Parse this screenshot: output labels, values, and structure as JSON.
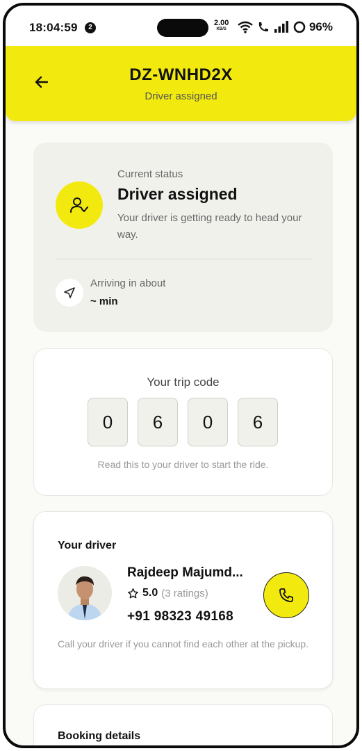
{
  "status_bar": {
    "time": "18:04:59",
    "notification_count": "2",
    "speed_value": "2.00",
    "speed_unit": "KB/S",
    "battery": "96%"
  },
  "header": {
    "title": "DZ-WNHD2X",
    "subtitle": "Driver assigned",
    "accent_color": "#f2ea0f"
  },
  "status_card": {
    "label": "Current status",
    "title": "Driver assigned",
    "description": "Your driver is getting ready to head your way.",
    "arrival_label": "Arriving in about",
    "arrival_value": "~ min"
  },
  "trip_code": {
    "title": "Your trip code",
    "digits": [
      "0",
      "6",
      "0",
      "6"
    ],
    "hint": "Read this to your driver to start the ride."
  },
  "driver": {
    "heading": "Your driver",
    "name": "Rajdeep Majumd...",
    "rating": "5.0",
    "ratings_count": "(3 ratings)",
    "phone": "+91 98323 49168",
    "note": "Call your driver if you cannot find each other at the pickup."
  },
  "booking": {
    "heading": "Booking details"
  },
  "icons": {
    "back": "arrow-left-icon",
    "status": "user-check-icon",
    "arrival": "navigation-icon",
    "rating": "star-outline-icon",
    "call": "phone-icon"
  }
}
